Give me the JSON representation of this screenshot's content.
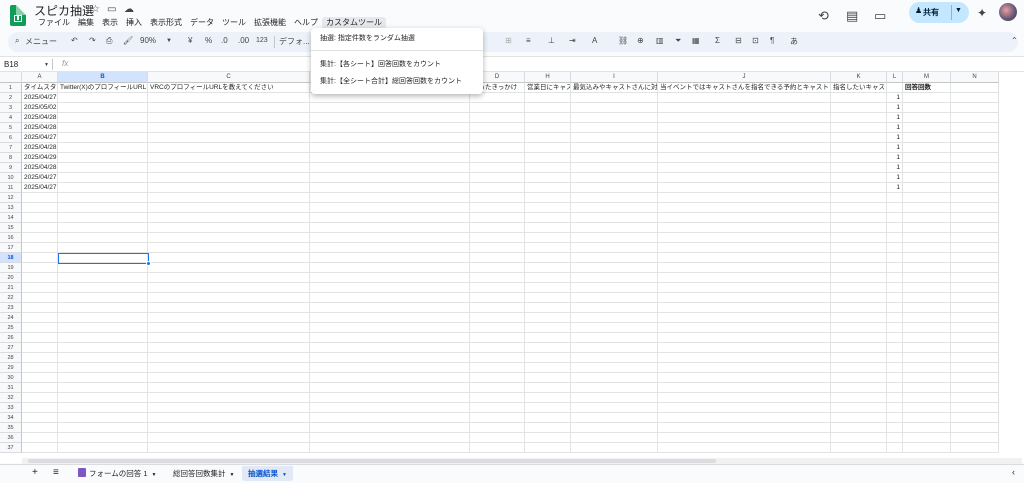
{
  "app": {
    "title": "スピカ抽選",
    "menus": [
      "ファイル",
      "編集",
      "表示",
      "挿入",
      "表示形式",
      "データ",
      "ツール",
      "拡張機能",
      "ヘルプ",
      "カスタムツール"
    ],
    "share_label": "共有"
  },
  "toolbar": {
    "search_label": "メニュー",
    "zoom": "90%",
    "currency": "¥",
    "percent": "%",
    "dec_dec": ".0",
    "dec_inc": ".00",
    "number_format": "123",
    "font": "デフォ..."
  },
  "formula_bar": {
    "name_box": "B18",
    "fx": "fx"
  },
  "custom_menu": {
    "items": [
      "抽選: 指定件数をランダム抽選",
      "集計:【各シート】回答回数をカウント",
      "集計:【全シート合計】総回答回数をカウント"
    ]
  },
  "sheet": {
    "columns": [
      "A",
      "B",
      "C",
      "D",
      "H",
      "I",
      "J",
      "K",
      "L",
      "M",
      "N"
    ],
    "header_row": [
      "タイムスタン",
      "Twitter(X)のプロフィールURLを",
      "VRCのプロフィールURLを教えてください",
      "知ったきっかけ",
      "営業日にキャス",
      "最気込みやキャストさんに対",
      "当イベントではキャストさんを指名できる予約とキャストさ",
      "指名したいキャスト",
      "",
      "回答回数",
      ""
    ],
    "dates": [
      "2025/04/27",
      "2025/05/02",
      "2025/04/28",
      "2025/04/28",
      "2025/04/27",
      "2025/04/28",
      "2025/04/29",
      "2025/04/28",
      "2025/04/27",
      "2025/04/27"
    ],
    "counts": [
      "1",
      "1",
      "1",
      "1",
      "1",
      "1",
      "1",
      "1",
      "1",
      "1"
    ],
    "row_count": 37
  },
  "tabs": {
    "add": "+",
    "list": "≡",
    "items": [
      "フォームの回答 1",
      "総回答回数集計",
      "抽選結果"
    ]
  }
}
